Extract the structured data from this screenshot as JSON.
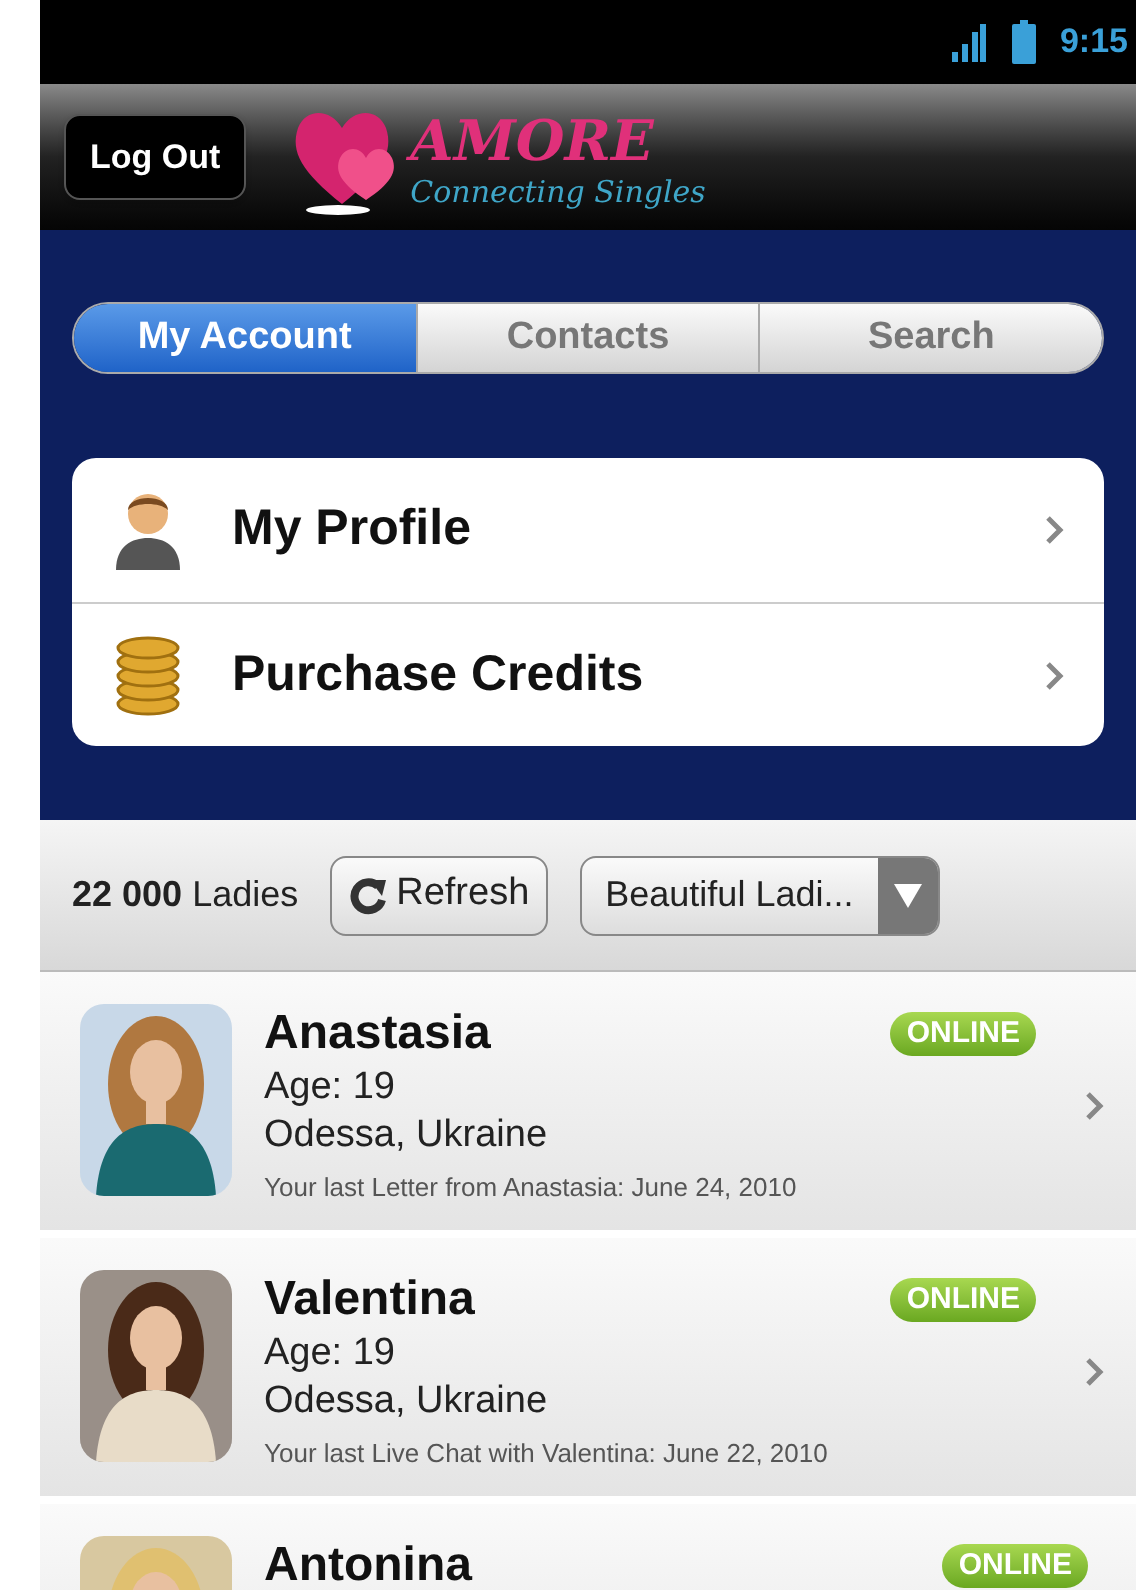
{
  "status_bar": {
    "time": "9:15"
  },
  "header": {
    "logout_button": "Log Out",
    "logo_title": "AMORE",
    "logo_tagline": "Connecting Singles"
  },
  "tabs": [
    {
      "label": "My Account",
      "selected": true
    },
    {
      "label": "Contacts",
      "selected": false
    },
    {
      "label": "Search",
      "selected": false
    }
  ],
  "menu": [
    {
      "label": "My Profile"
    },
    {
      "label": "Purchase Credits"
    }
  ],
  "toolbar": {
    "count": "**22 000** Ladies",
    "refresh_button": "Refresh",
    "filter": "Beautiful Ladi..."
  },
  "profiles": [
    {
      "name": "Anastasia",
      "age": "Age: 19",
      "location": "Odessa, Ukraine",
      "last_contact": "Your last Letter from Anastasia: June 24, 2010",
      "status": "ONLINE"
    },
    {
      "name": "Valentina",
      "age": "Age: 19",
      "location": "Odessa, Ukraine",
      "last_contact": "Your last Live Chat with Valentina: June 22, 2010",
      "status": "ONLINE"
    },
    {
      "name": "Antonina",
      "status": "ONLINE"
    }
  ]
}
